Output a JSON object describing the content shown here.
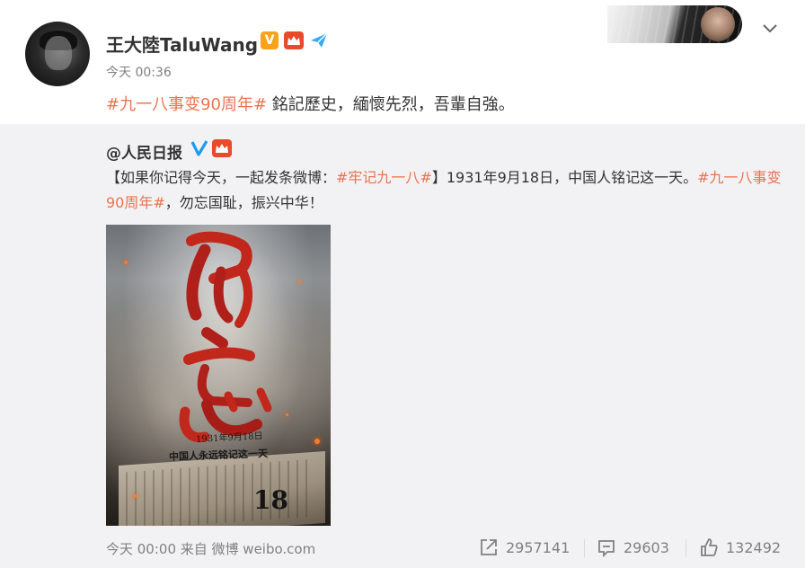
{
  "post": {
    "username": "王大陸TaluWang",
    "time": "今天 00:36",
    "topic": "#九一八事变90周年#",
    "text": " 銘記歷史，緬懷先烈，吾輩自強。",
    "badges": [
      "vip-v-badge",
      "crown-badge",
      "plane-badge"
    ],
    "badge_v_label": "V"
  },
  "repost": {
    "username": "@人民日报",
    "text_part1": "【如果你记得今天，一起发条微博：",
    "topic1": "#牢记九一八#",
    "text_part2": "】1931年9月18日，中国人铭记这一天。",
    "topic2": "#九一八事变90周年#",
    "text_part3": "，勿忘国耻，振兴中华！",
    "image": {
      "big_chars": "勿忘",
      "date_handwritten": "1931年9月18日",
      "caption_handwritten": "中国人永远铭记这一天",
      "number": "18"
    },
    "source": "今天 00:00 来自 微博 weibo.com",
    "stats": {
      "reposts": "2957141",
      "comments": "29603",
      "likes": "132492"
    }
  },
  "colors": {
    "topic": "#eb7350",
    "repost_bg": "#f2f2f5",
    "verified_blue": "#1e9bf0",
    "vip_orange": "#f7a21b",
    "text_main": "#333333",
    "text_muted": "#808080"
  },
  "icons": {
    "chevron": "chevron-down-icon",
    "repost": "share-icon",
    "comment": "comment-icon",
    "like": "thumbs-up-icon"
  }
}
